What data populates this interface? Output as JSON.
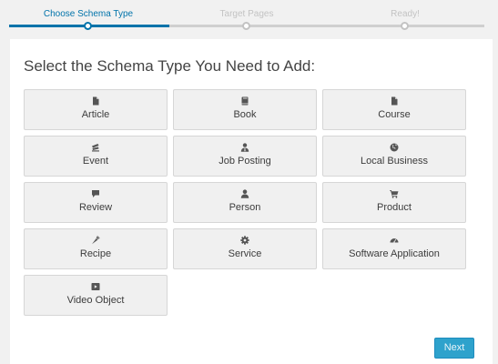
{
  "steps": [
    {
      "label": "Choose Schema Type",
      "state": "active"
    },
    {
      "label": "Target Pages",
      "state": "inactive"
    },
    {
      "label": "Ready!",
      "state": "inactive"
    }
  ],
  "heading": "Select the Schema Type You Need to Add:",
  "schema_types": [
    {
      "label": "Article",
      "icon": "document-icon"
    },
    {
      "label": "Book",
      "icon": "book-icon"
    },
    {
      "label": "Course",
      "icon": "document-icon"
    },
    {
      "label": "Event",
      "icon": "ticket-icon"
    },
    {
      "label": "Job Posting",
      "icon": "user-tie-icon"
    },
    {
      "label": "Local Business",
      "icon": "globe-icon"
    },
    {
      "label": "Review",
      "icon": "comment-icon"
    },
    {
      "label": "Person",
      "icon": "person-icon"
    },
    {
      "label": "Product",
      "icon": "cart-icon"
    },
    {
      "label": "Recipe",
      "icon": "carrot-icon"
    },
    {
      "label": "Service",
      "icon": "gear-icon"
    },
    {
      "label": "Software Application",
      "icon": "speedometer-icon"
    },
    {
      "label": "Video Object",
      "icon": "video-icon"
    }
  ],
  "next_label": "Next",
  "colors": {
    "accent": "#0073aa",
    "button": "#2ea2cc",
    "icon": "#555555"
  }
}
